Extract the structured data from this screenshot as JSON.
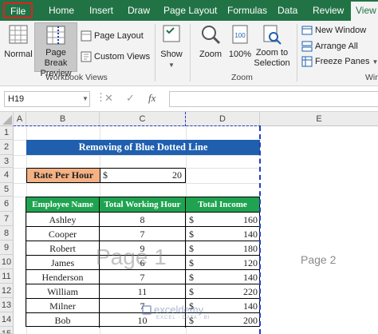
{
  "tabs": [
    "File",
    "Home",
    "Insert",
    "Draw",
    "Page Layout",
    "Formulas",
    "Data",
    "Review",
    "View"
  ],
  "ribbon": {
    "normal": "Normal",
    "page_break_1": "Page Break",
    "page_break_2": "Preview",
    "page_layout": "Page Layout",
    "custom_views": "Custom Views",
    "show": "Show",
    "zoom": "Zoom",
    "hundred": "100%",
    "zoom_sel_1": "Zoom to",
    "zoom_sel_2": "Selection",
    "new_window": "New Window",
    "arrange_all": "Arrange All",
    "freeze_panes": "Freeze Panes",
    "group_workbook": "Workbook Views",
    "group_zoom": "Zoom",
    "group_window": "Win"
  },
  "name_box": "H19",
  "fx": "fx",
  "columns": [
    "A",
    "B",
    "C",
    "D",
    "E"
  ],
  "rows": [
    "1",
    "2",
    "3",
    "4",
    "5",
    "6",
    "7",
    "8",
    "9",
    "10",
    "11",
    "12",
    "13",
    "14",
    "15"
  ],
  "title": "Removing of Blue Dotted Line",
  "rate": {
    "label": "Rate Per Hour",
    "currency": "$",
    "value": "20"
  },
  "table": {
    "headers": [
      "Employee Name",
      "Total Working Hour",
      "Total Income"
    ],
    "rows": [
      {
        "name": "Ashley",
        "hours": "8",
        "cur": "$",
        "income": "160"
      },
      {
        "name": "Cooper",
        "hours": "7",
        "cur": "$",
        "income": "140"
      },
      {
        "name": "Robert",
        "hours": "9",
        "cur": "$",
        "income": "180"
      },
      {
        "name": "James",
        "hours": "6",
        "cur": "$",
        "income": "120"
      },
      {
        "name": "Henderson",
        "hours": "7",
        "cur": "$",
        "income": "140"
      },
      {
        "name": "William",
        "hours": "11",
        "cur": "$",
        "income": "220"
      },
      {
        "name": "Milner",
        "hours": "7",
        "cur": "$",
        "income": "140"
      },
      {
        "name": "Bob",
        "hours": "10",
        "cur": "$",
        "income": "200"
      }
    ]
  },
  "watermarks": {
    "page1": "Page 1",
    "page2": "Page 2",
    "brand": "exceldemy",
    "brand_sub": "EXCEL · DATA · BI"
  },
  "colors": {
    "accent": "#217346",
    "title_bg": "#1f5fae",
    "header_bg": "#1fa351",
    "rate_bg": "#f4b183",
    "page_break": "#1f3fbf"
  }
}
